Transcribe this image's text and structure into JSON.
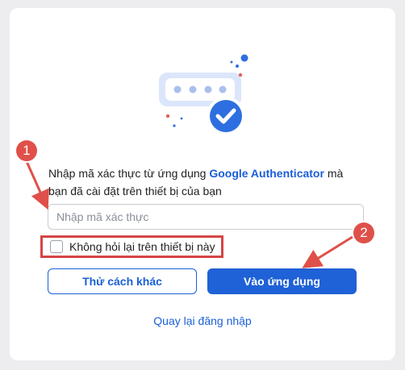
{
  "description": {
    "prefix": "Nhập mã xác thực từ ứng dụng ",
    "app_name": "Google Authenticator",
    "suffix": " mà bạn đã cài đặt trên thiết bị của bạn"
  },
  "code_input": {
    "placeholder": "Nhập mã xác thực",
    "value": ""
  },
  "remember_device": {
    "label": "Không hỏi lại trên thiết bị này",
    "checked": false
  },
  "buttons": {
    "other_method": "Thử cách khác",
    "open_app": "Vào ứng dụng"
  },
  "back_link": "Quay lại đăng nhập",
  "annotations": {
    "step1": "1",
    "step2": "2"
  },
  "colors": {
    "accent": "#1f61d6",
    "annotation": "#e0504a",
    "background": "#ededef"
  },
  "icons": {
    "illustration": "verified-code-icon"
  }
}
